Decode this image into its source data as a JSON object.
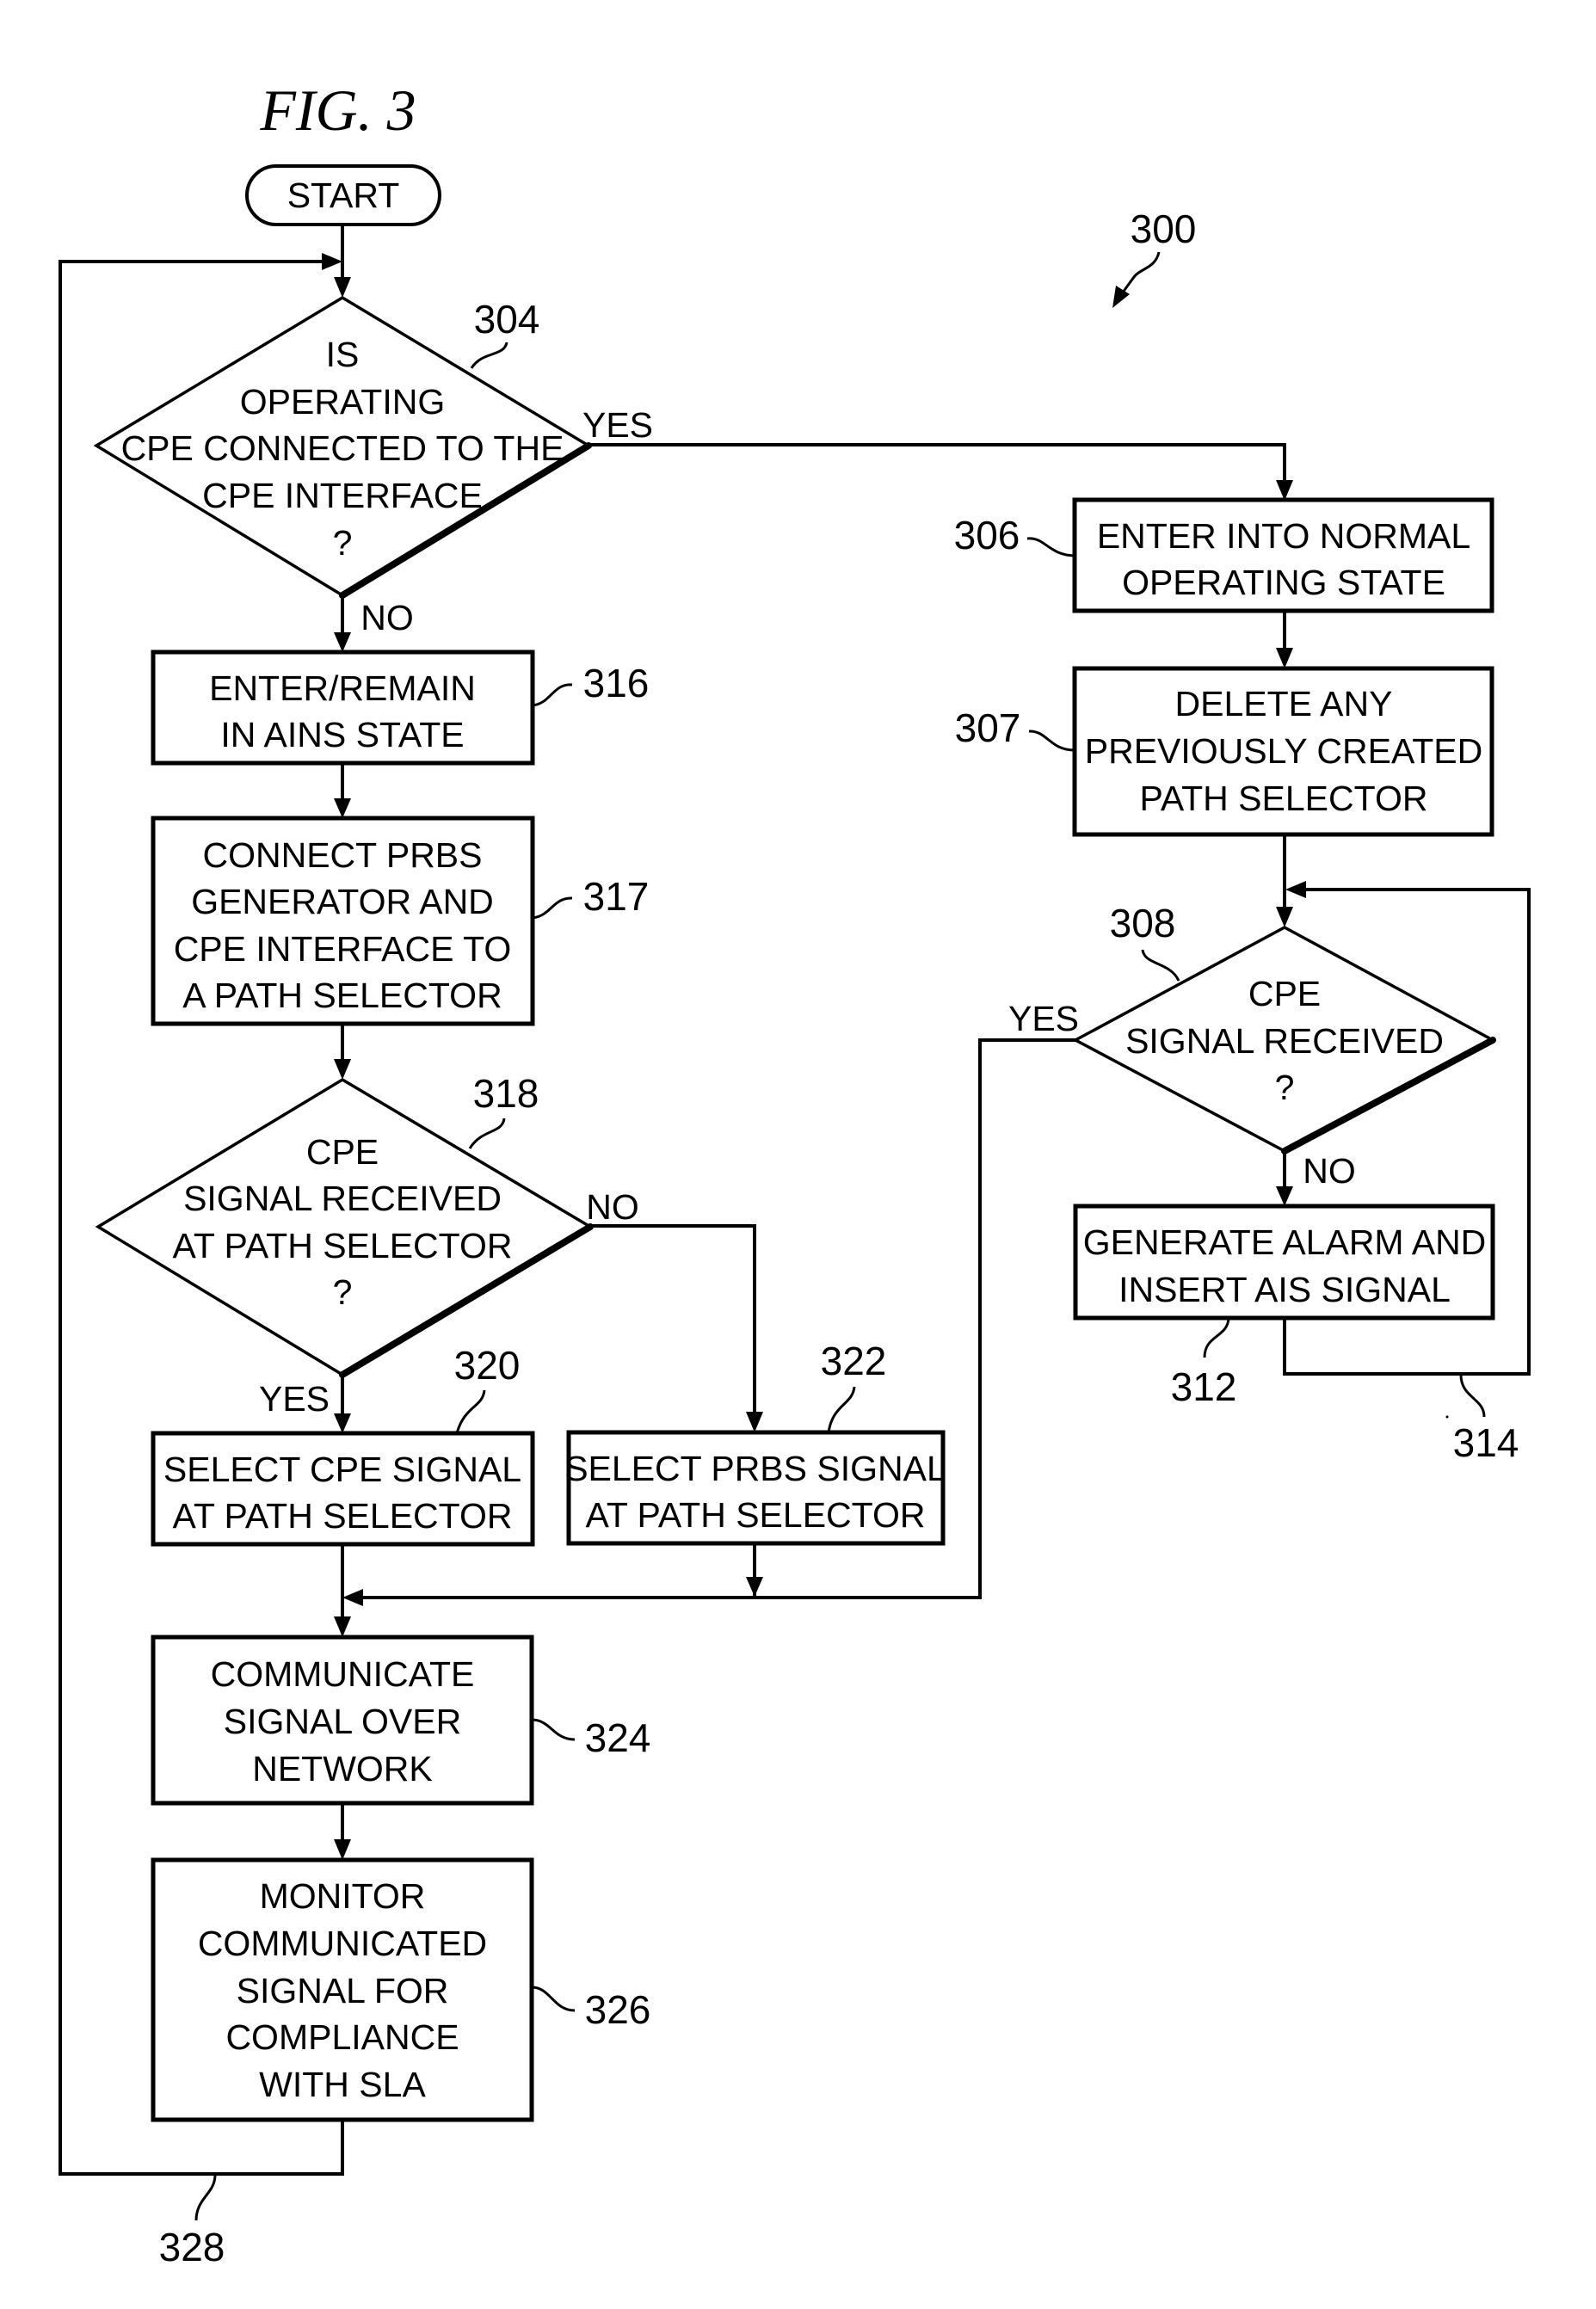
{
  "figure": {
    "title": "FIG. 3",
    "reference": "300"
  },
  "nodes": {
    "start": {
      "label": "START"
    },
    "n304": {
      "ref": "304",
      "lines": [
        "IS",
        "OPERATING",
        "CPE CONNECTED TO THE",
        "CPE INTERFACE",
        "?"
      ],
      "yes": "YES",
      "no": "NO"
    },
    "n306": {
      "ref": "306",
      "lines": [
        "ENTER INTO NORMAL",
        "OPERATING STATE"
      ]
    },
    "n307": {
      "ref": "307",
      "lines": [
        "DELETE ANY",
        "PREVIOUSLY CREATED",
        "PATH SELECTOR"
      ]
    },
    "n308": {
      "ref": "308",
      "lines": [
        "CPE",
        "SIGNAL RECEIVED",
        "?"
      ],
      "yes": "YES",
      "no": "NO"
    },
    "n312": {
      "ref": "312",
      "lines": [
        "GENERATE ALARM AND",
        "INSERT AIS SIGNAL"
      ]
    },
    "n314": {
      "ref": "314"
    },
    "n316": {
      "ref": "316",
      "lines": [
        "ENTER/REMAIN",
        "IN AINS STATE"
      ]
    },
    "n317": {
      "ref": "317",
      "lines": [
        "CONNECT PRBS",
        "GENERATOR AND",
        "CPE INTERFACE TO",
        "A PATH SELECTOR"
      ]
    },
    "n318": {
      "ref": "318",
      "lines": [
        "CPE",
        "SIGNAL RECEIVED",
        "AT PATH SELECTOR",
        "?"
      ],
      "yes": "YES",
      "no": "NO"
    },
    "n320": {
      "ref": "320",
      "lines": [
        "SELECT CPE SIGNAL",
        "AT PATH SELECTOR"
      ]
    },
    "n322": {
      "ref": "322",
      "lines": [
        "SELECT PRBS SIGNAL",
        "AT PATH SELECTOR"
      ]
    },
    "n324": {
      "ref": "324",
      "lines": [
        "COMMUNICATE",
        "SIGNAL OVER",
        "NETWORK"
      ]
    },
    "n326": {
      "ref": "326",
      "lines": [
        "MONITOR",
        "COMMUNICATED",
        "SIGNAL FOR",
        "COMPLIANCE",
        "WITH SLA"
      ]
    },
    "n328": {
      "ref": "328"
    }
  }
}
